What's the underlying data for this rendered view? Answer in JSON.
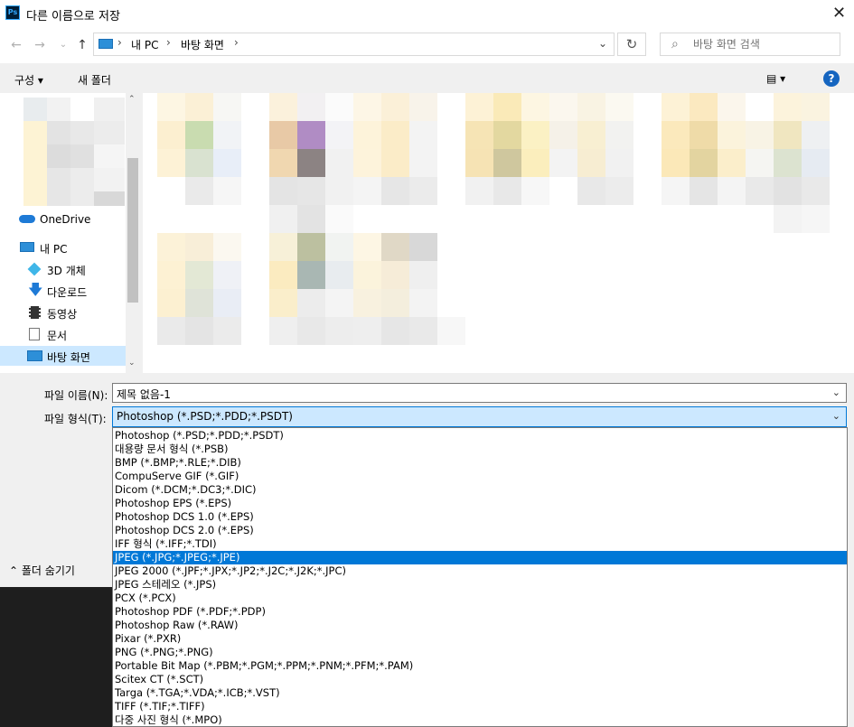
{
  "title": "다른 이름으로 저장",
  "app_icon": "Ps",
  "nav": {
    "back_icon": "←",
    "forward_icon": "→",
    "recent_icon": "⌄",
    "up_icon": "↑",
    "breadcrumbs": [
      "내 PC",
      "바탕 화면"
    ],
    "refresh_icon": "↻"
  },
  "search": {
    "placeholder": "바탕 화면 검색"
  },
  "toolbar": {
    "organize_label": "구성 ▾",
    "new_folder_label": "새 폴더",
    "view_label": "▤ ▾",
    "help_label": "?"
  },
  "sidebar": {
    "items": [
      {
        "label": "OneDrive",
        "icon": "cloud-icon"
      },
      {
        "label": "내 PC",
        "icon": "pc-icon"
      },
      {
        "label": "3D 개체",
        "icon": "cube-icon"
      },
      {
        "label": "다운로드",
        "icon": "download-icon"
      },
      {
        "label": "동영상",
        "icon": "video-icon"
      },
      {
        "label": "문서",
        "icon": "document-icon"
      },
      {
        "label": "바탕 화면",
        "icon": "desktop-icon",
        "selected": true
      }
    ]
  },
  "bottom": {
    "filename_label": "파일 이름(N):",
    "filename_value": "제목 없음-1",
    "filetype_label": "파일 형식(T):",
    "filetype_value": "Photoshop (*.PSD;*.PDD;*.PSDT)",
    "hide_folders_label": "폴더 숨기기"
  },
  "filetype_options": [
    "Photoshop (*.PSD;*.PDD;*.PSDT)",
    "대용량 문서 형식 (*.PSB)",
    "BMP (*.BMP;*.RLE;*.DIB)",
    "CompuServe GIF (*.GIF)",
    "Dicom (*.DCM;*.DC3;*.DIC)",
    "Photoshop EPS (*.EPS)",
    "Photoshop DCS 1.0 (*.EPS)",
    "Photoshop DCS 2.0 (*.EPS)",
    "IFF 형식 (*.IFF;*.TDI)",
    "JPEG (*.JPG;*.JPEG;*.JPE)",
    "JPEG 2000 (*.JPF;*.JPX;*.JP2;*.J2C;*.J2K;*.JPC)",
    "JPEG 스테레오 (*.JPS)",
    "PCX (*.PCX)",
    "Photoshop PDF (*.PDF;*.PDP)",
    "Photoshop Raw (*.RAW)",
    "Pixar (*.PXR)",
    "PNG (*.PNG;*.PNG)",
    "Portable Bit Map (*.PBM;*.PGM;*.PPM;*.PNM;*.PFM;*.PAM)",
    "Scitex CT (*.SCT)",
    "Targa (*.TGA;*.VDA;*.ICB;*.VST)",
    "TIFF (*.TIF;*.TIFF)",
    "다중 사진 형식 (*.MPO)"
  ],
  "selected_option_index": 9,
  "colors": {
    "accent": "#0078d7",
    "selection_bg": "#cce8ff",
    "highlight": "#0078d7"
  }
}
